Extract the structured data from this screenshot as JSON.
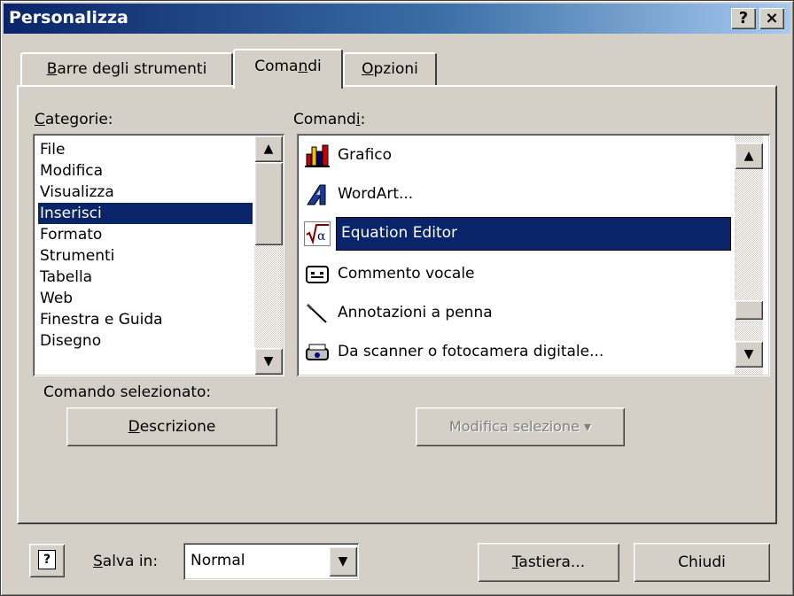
{
  "window": {
    "title": "Personalizza",
    "help_btn": "?",
    "close_btn": "×"
  },
  "tabs": [
    {
      "label": "Barre degli strumenti",
      "accel": "B",
      "rest": "arre degli strumenti"
    },
    {
      "label": "Comandi",
      "pre": "Coma",
      "accel": "n",
      "rest": "di"
    },
    {
      "label": "Opzioni",
      "accel": "O",
      "rest": "pzioni"
    }
  ],
  "categories": {
    "label_accel": "C",
    "label_rest": "ategorie:",
    "items": [
      "File",
      "Modifica",
      "Visualizza",
      "Inserisci",
      "Formato",
      "Strumenti",
      "Tabella",
      "Web",
      "Finestra e Guida",
      "Disegno"
    ],
    "selected": "Inserisci"
  },
  "commands": {
    "label_pre": "Comand",
    "label_accel": "i",
    "label_rest": ":",
    "items": [
      {
        "label": "Grafico",
        "icon": "chart-icon"
      },
      {
        "label": "WordArt...",
        "icon": "wordart-icon"
      },
      {
        "label": "Equation Editor",
        "icon": "equation-icon"
      },
      {
        "label": "Commento vocale",
        "icon": "voice-comment-icon"
      },
      {
        "label": "Annotazioni a penna",
        "icon": "pen-icon"
      },
      {
        "label": "Da scanner o fotocamera digitale...",
        "icon": "scanner-icon"
      }
    ],
    "selected": "Equation Editor"
  },
  "selected_command": {
    "label": "Comando selezionato:",
    "description_accel": "D",
    "description_rest": "escrizione",
    "modify_label": "Modifica selezione ▾"
  },
  "footer": {
    "help_icon": "?",
    "save_in_accel": "S",
    "save_in_rest": "alva in:",
    "save_in_value": "Normal",
    "keyboard_accel": "T",
    "keyboard_rest": "astiera...",
    "close_label": "Chiudi"
  },
  "colors": {
    "selection": "#0a246a",
    "face": "#d4d0c8"
  }
}
